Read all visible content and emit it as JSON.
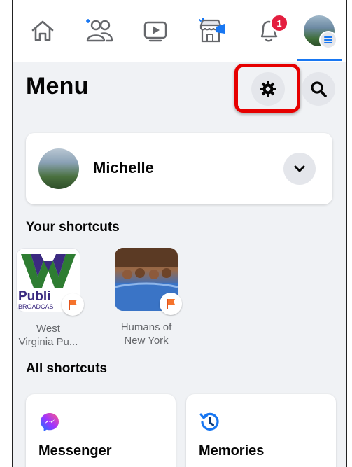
{
  "nav": {
    "items": [
      {
        "icon": "home-icon"
      },
      {
        "icon": "friends-icon"
      },
      {
        "icon": "watch-icon"
      },
      {
        "icon": "marketplace-icon"
      },
      {
        "icon": "notifications-icon",
        "badge": "1"
      },
      {
        "icon": "profile-menu-icon"
      }
    ],
    "active_index": 5
  },
  "header": {
    "title": "Menu",
    "settings_icon": "gear-icon",
    "search_icon": "search-icon"
  },
  "profile": {
    "name": "Michelle",
    "expand_icon": "chevron-down-icon"
  },
  "shortcuts": {
    "title": "Your shortcuts",
    "items": [
      {
        "line1": "West",
        "line2": "Virginia Pu...",
        "logo_text": "Publi",
        "logo_sub": "BROADCAS"
      },
      {
        "line1": "Humans of",
        "line2": "New York"
      }
    ]
  },
  "all_shortcuts": {
    "title": "All shortcuts",
    "tiles": [
      {
        "label": "Messenger",
        "icon": "messenger-icon"
      },
      {
        "label": "Memories",
        "icon": "memories-icon"
      }
    ]
  },
  "colors": {
    "accent": "#1877f2",
    "badge": "#e41e3f",
    "highlight": "#e60000"
  }
}
